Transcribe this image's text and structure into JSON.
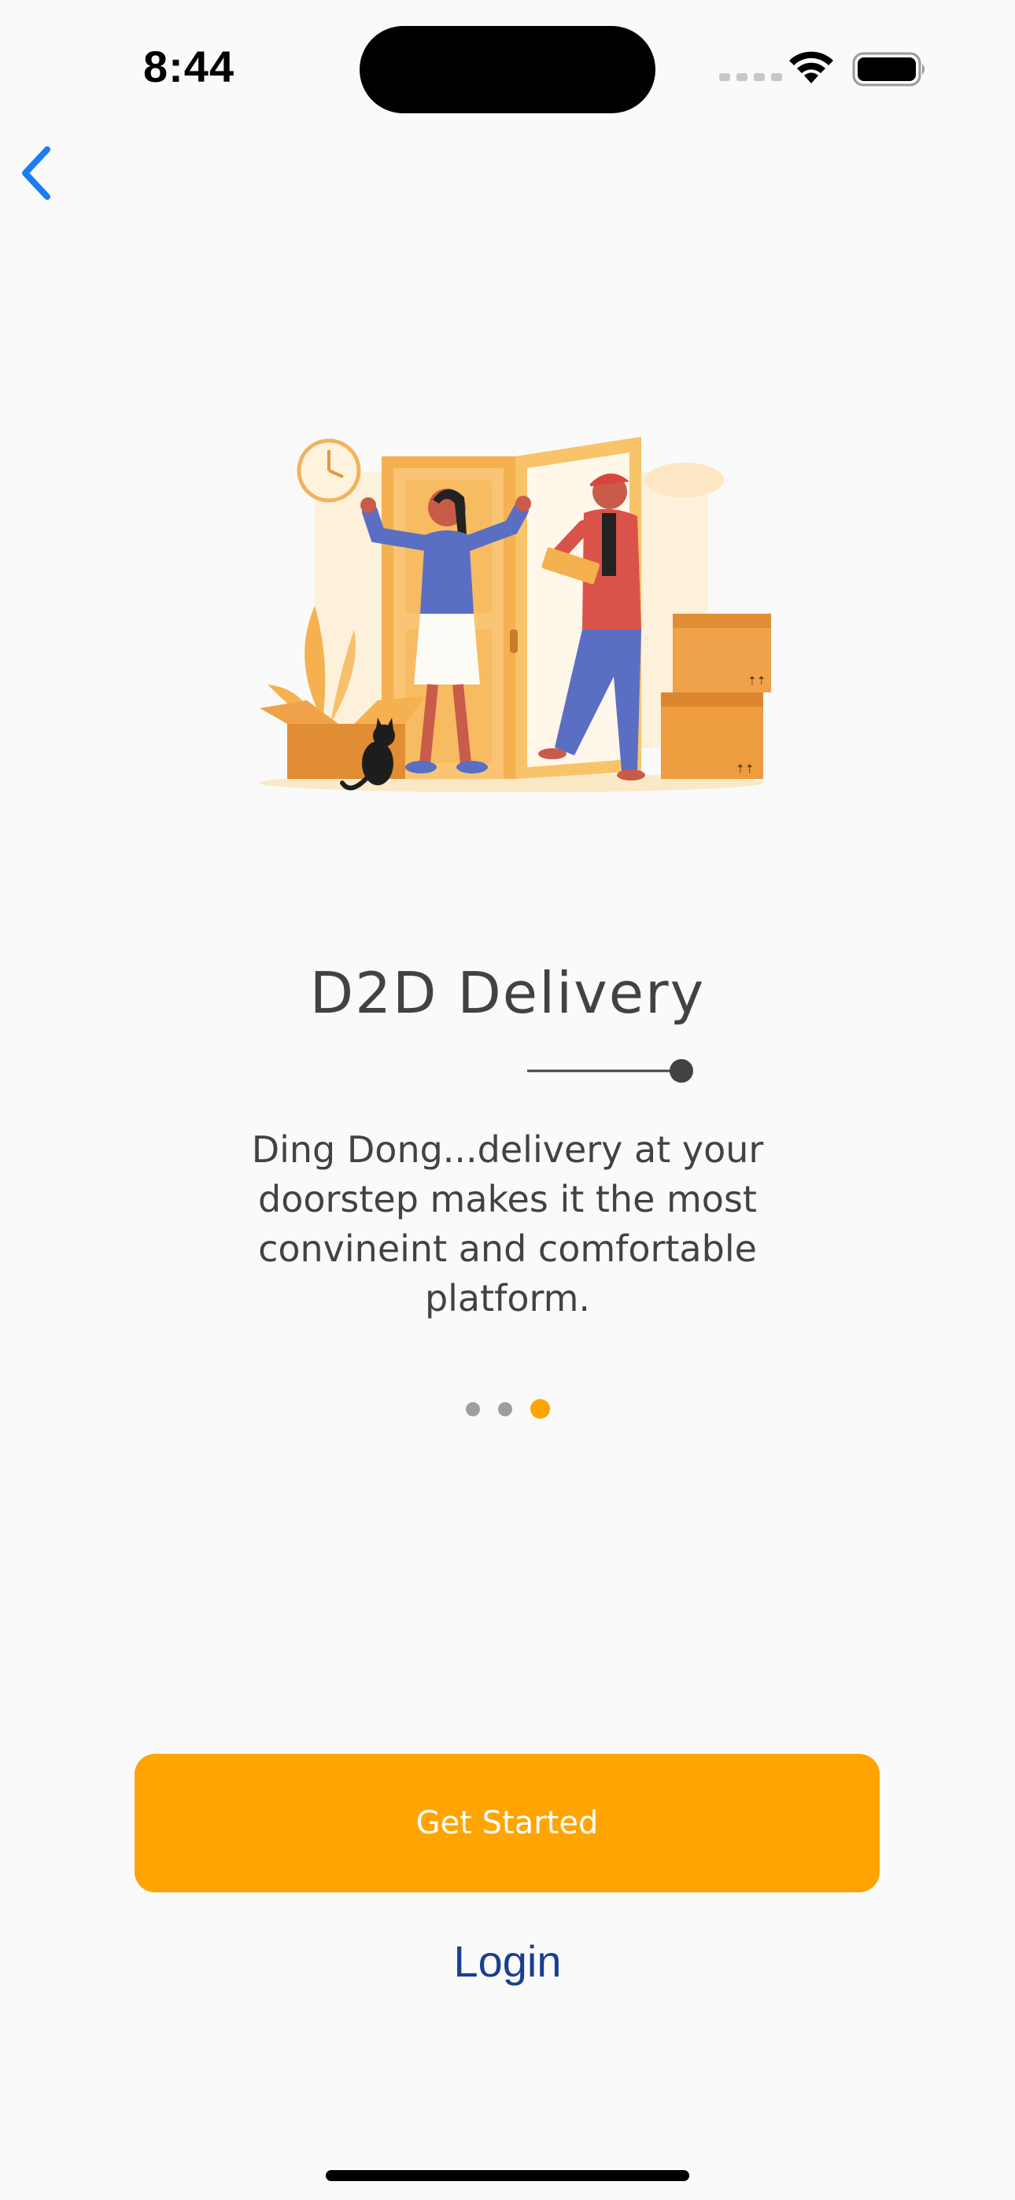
{
  "status_bar": {
    "time": "8:44"
  },
  "nav": {
    "back_icon": "chevron-left-icon"
  },
  "onboarding": {
    "illustration": "door-delivery-illustration",
    "title": "D2D Delivery",
    "description": "Ding Dong...delivery at your doorstep makes it the most convineint and comfortable platform.",
    "page_count": 3,
    "current_page": 3
  },
  "actions": {
    "primary_label": "Get Started",
    "secondary_label": "Login"
  },
  "colors": {
    "accent": "#ffa400",
    "link": "#1a3f8f",
    "back_icon": "#1a7cf5",
    "text": "#424242",
    "background": "#fafafa"
  }
}
